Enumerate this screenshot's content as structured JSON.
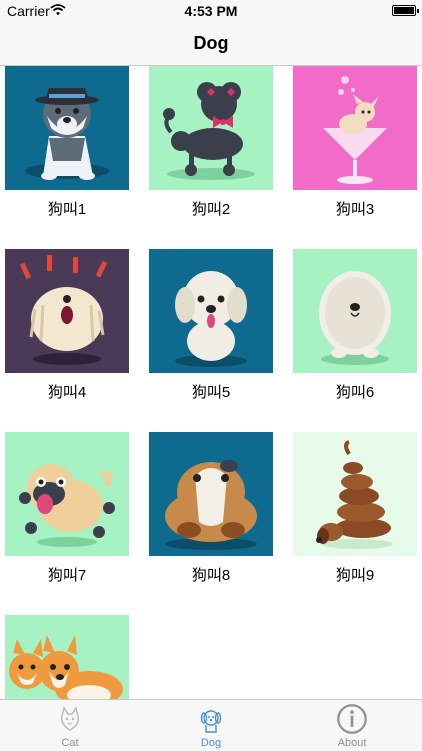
{
  "status": {
    "carrier": "Carrier",
    "time": "4:53 PM",
    "battery": "full"
  },
  "nav": {
    "title": "Dog"
  },
  "items": [
    {
      "label": "狗叫1",
      "bg": "#0e6a8e",
      "icon": "husky-dog-icon"
    },
    {
      "label": "狗叫2",
      "bg": "#a6f2c2",
      "icon": "poodle-dog-icon"
    },
    {
      "label": "狗叫3",
      "bg": "#f26bc9",
      "icon": "chihuahua-in-martini-glass-icon"
    },
    {
      "label": "狗叫4",
      "bg": "#4a3a57",
      "icon": "barking-komondor-dog-icon"
    },
    {
      "label": "狗叫5",
      "bg": "#0e6a8e",
      "icon": "maltese-dog-icon"
    },
    {
      "label": "狗叫6",
      "bg": "#a6f2c2",
      "icon": "fluffy-sheepdog-icon"
    },
    {
      "label": "狗叫7",
      "bg": "#a6f2c2",
      "icon": "pug-dog-icon"
    },
    {
      "label": "狗叫8",
      "bg": "#0e6a8e",
      "icon": "bulldog-icon"
    },
    {
      "label": "狗叫9",
      "bg": "#e6fbe9",
      "icon": "dachshund-dog-icon"
    },
    {
      "label": "",
      "bg": "#a6f2c2",
      "icon": "corgi-dogs-icon"
    }
  ],
  "tabs": [
    {
      "label": "Cat",
      "icon": "cat-icon",
      "active": false
    },
    {
      "label": "Dog",
      "icon": "dog-icon",
      "active": true
    },
    {
      "label": "About",
      "icon": "info-icon",
      "active": false
    }
  ],
  "colors": {
    "accent": "#4a90d9",
    "inactive": "#929292"
  }
}
